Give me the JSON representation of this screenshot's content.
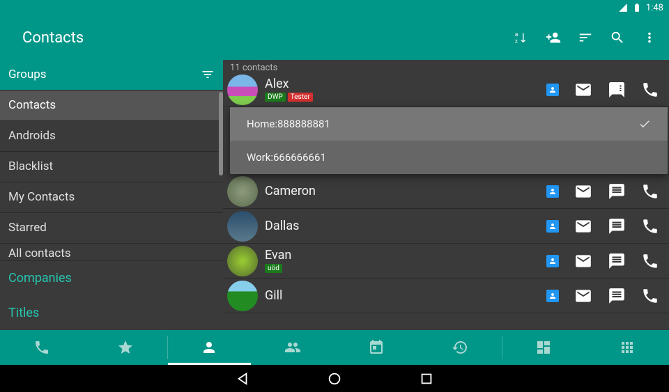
{
  "status": {
    "time": "1:48"
  },
  "toolbar": {
    "title": "Contacts"
  },
  "sidebar": {
    "header": "Groups",
    "items": [
      "Contacts",
      "Androids",
      "Blacklist",
      "My Contacts",
      "Starred",
      "All contacts"
    ],
    "bottom": [
      "Companies",
      "Titles"
    ]
  },
  "main": {
    "count": "11 contacts",
    "contacts": [
      {
        "name": "Alex",
        "tags": [
          {
            "text": "DWP",
            "color": "green"
          },
          {
            "text": "Tester",
            "color": "red"
          }
        ]
      },
      {
        "name": "Cameron"
      },
      {
        "name": "Dallas"
      },
      {
        "name": "Evan",
        "tags": [
          {
            "text": "uöd",
            "color": "green"
          }
        ]
      },
      {
        "name": "Gill"
      }
    ],
    "dropdown": [
      {
        "label": "Home:888888881",
        "checked": true
      },
      {
        "label": "Work:666666661",
        "checked": false
      }
    ]
  }
}
